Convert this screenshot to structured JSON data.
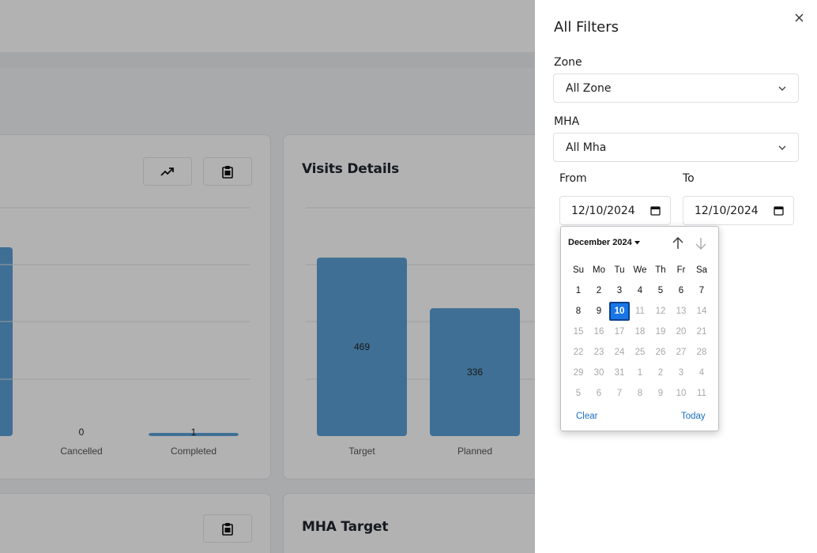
{
  "dashboard": {
    "cards": {
      "left_chart": {
        "chart_data": {
          "type": "bar",
          "categories": [
            "Cancelled",
            "Completed"
          ],
          "values": [
            0,
            1
          ],
          "value_labels": [
            "0",
            "1"
          ]
        }
      },
      "visits": {
        "title": "Visits Details",
        "chart_data": {
          "type": "bar",
          "categories": [
            "Target",
            "Planned"
          ],
          "values": [
            469,
            336
          ],
          "value_labels": [
            "469",
            "336"
          ]
        }
      },
      "mha_target": {
        "title": "MHA Target"
      }
    },
    "icons": {
      "trend": "trending-up-icon",
      "clipboard": "clipboard-icon"
    }
  },
  "filters": {
    "title": "All Filters",
    "zone": {
      "label": "Zone",
      "value": "All Zone"
    },
    "mha": {
      "label": "MHA",
      "value": "All Mha"
    },
    "from": {
      "label": "From",
      "value": "12/10/2024"
    },
    "to": {
      "label": "To",
      "value": "12/10/2024"
    }
  },
  "calendar": {
    "month_label": "December 2024",
    "weekdays": [
      "Su",
      "Mo",
      "Tu",
      "We",
      "Th",
      "Fr",
      "Sa"
    ],
    "weeks": [
      [
        "1",
        "2",
        "3",
        "4",
        "5",
        "6",
        "7"
      ],
      [
        "8",
        "9",
        "10",
        "11",
        "12",
        "13",
        "14"
      ],
      [
        "15",
        "16",
        "17",
        "18",
        "19",
        "20",
        "21"
      ],
      [
        "22",
        "23",
        "24",
        "25",
        "26",
        "27",
        "28"
      ],
      [
        "29",
        "30",
        "31",
        "1",
        "2",
        "3",
        "4"
      ],
      [
        "5",
        "6",
        "7",
        "8",
        "9",
        "10",
        "11"
      ]
    ],
    "selected": "10",
    "clear_label": "Clear",
    "today_label": "Today",
    "colors": {
      "selected": "#1976e6",
      "link": "#1a6fc4",
      "muted": "#a8a8a8"
    }
  },
  "colors": {
    "bar": "#5b9fd4",
    "overlay": "rgba(0,0,0,0.30)"
  }
}
